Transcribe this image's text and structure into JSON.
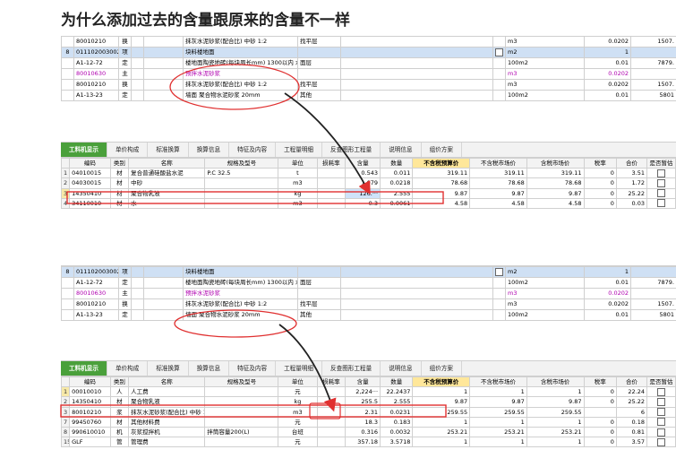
{
  "title": "为什么添加过去的含量跟原来的含量不一样",
  "tabs": [
    "工料机显示",
    "单价构成",
    "标准换算",
    "换算信息",
    "特征及内容",
    "工程量明细",
    "反查图形工程量",
    "说明信息",
    "组价方案"
  ],
  "columns": [
    "编码",
    "类别",
    "名称",
    "规格及型号",
    "单位",
    "损耗率",
    "含量",
    "数量",
    "不含税预算价",
    "不含税市场价",
    "含税市场价",
    "税率",
    "合价",
    "是否暂估"
  ],
  "top_quota": [
    {
      "num": "",
      "code": "80010210",
      "type": "换",
      "name": "抹灰水泥砂浆(配合比) 中砂 1:2",
      "feat": "找平层",
      "unit": "m3",
      "qty": "0.0202",
      "price": "1507."
    },
    {
      "num": "8",
      "code": "011102003002",
      "type": "项",
      "name": "块料楼地面",
      "feat": "",
      "unit": "m2",
      "qty": "1",
      "price": ""
    },
    {
      "num": "",
      "code": "A1-12-72",
      "type": "定",
      "name": "楼地面陶瓷地砖(每块周长mm) 1300以内 水泥砂浆",
      "feat": "面层",
      "unit": "100m2",
      "qty": "0.01",
      "price": "7879."
    },
    {
      "num": "",
      "code": "80010630",
      "type": "主",
      "name": "预拌水泥砂浆",
      "feat": "",
      "unit": "m3",
      "qty": "0.0202",
      "price": ""
    },
    {
      "num": "",
      "code": "80010210",
      "type": "换",
      "name": "抹灰水泥砂浆(配合比) 中砂 1:2",
      "feat": "找平层",
      "unit": "m3",
      "qty": "0.0202",
      "price": "1507."
    },
    {
      "num": "",
      "code": "A1-13-23",
      "type": "定",
      "name": "墙面 聚合物水泥砂浆 20mm",
      "feat": "其他",
      "unit": "100m2",
      "qty": "0.01",
      "price": "5801"
    }
  ],
  "top_resources": [
    {
      "n": "1",
      "code": "04010015",
      "type": "材",
      "name": "复合普通硅酸盐水泥",
      "spec": "P.C 32.5",
      "unit": "t",
      "loss": "",
      "content": "0.543",
      "qty": "0.011",
      "p1": "319.11",
      "p2": "319.11",
      "p3": "319.11",
      "tax": "0",
      "sum": "3.51"
    },
    {
      "n": "2",
      "code": "04030015",
      "type": "材",
      "name": "中砂",
      "spec": "",
      "unit": "m3",
      "loss": "",
      "content": "1.079",
      "qty": "0.0218",
      "p1": "78.68",
      "p2": "78.68",
      "p3": "78.68",
      "tax": "0",
      "sum": "1.72"
    },
    {
      "n": "3",
      "code": "14350410",
      "type": "材",
      "name": "聚合物乳液",
      "spec": "",
      "unit": "kg",
      "loss": "",
      "content": "126.···",
      "qty": "2.555",
      "p1": "9.87",
      "p2": "9.87",
      "p3": "9.87",
      "tax": "0",
      "sum": "25.22"
    },
    {
      "n": "4",
      "code": "34110010",
      "type": "材",
      "name": "水",
      "spec": "",
      "unit": "m3",
      "loss": "",
      "content": "0.3",
      "qty": "0.0061",
      "p1": "4.58",
      "p2": "4.58",
      "p3": "4.58",
      "tax": "0",
      "sum": "0.03"
    }
  ],
  "bottom_quota": [
    {
      "num": "8",
      "code": "011102003002",
      "type": "项",
      "name": "块料楼地面",
      "feat": "",
      "unit": "m2",
      "qty": "1",
      "price": ""
    },
    {
      "num": "",
      "code": "A1-12-72",
      "type": "定",
      "name": "楼地面陶瓷地砖(每块周长mm) 1300以内 水泥砂浆",
      "feat": "面层",
      "unit": "100m2",
      "qty": "0.01",
      "price": "7879."
    },
    {
      "num": "",
      "code": "80010630",
      "type": "主",
      "name": "预拌水泥砂浆",
      "feat": "",
      "unit": "m3",
      "qty": "0.0202",
      "price": ""
    },
    {
      "num": "",
      "code": "80010210",
      "type": "换",
      "name": "抹灰水泥砂浆(配合比) 中砂 1:2",
      "feat": "找平层",
      "unit": "m3",
      "qty": "0.0202",
      "price": "1507."
    },
    {
      "num": "",
      "code": "A1-13-23",
      "type": "定",
      "name": "墙面 聚合物水泥砂浆 20mm",
      "feat": "其他",
      "unit": "100m2",
      "qty": "0.01",
      "price": "5801"
    }
  ],
  "bottom_resources": [
    {
      "n": "1",
      "code": "00010010",
      "type": "人",
      "name": "人工费",
      "spec": "",
      "unit": "元",
      "loss": "",
      "content": "2,224···",
      "qty": "22.2437",
      "p1": "1",
      "p2": "1",
      "p3": "1",
      "tax": "0",
      "sum": "22.24"
    },
    {
      "n": "2",
      "code": "14350410",
      "type": "材",
      "name": "聚合物乳液",
      "spec": "",
      "unit": "kg",
      "loss": "",
      "content": "255.5",
      "qty": "2.555",
      "p1": "9.87",
      "p2": "9.87",
      "p3": "9.87",
      "tax": "0",
      "sum": "25.22"
    },
    {
      "n": "3",
      "code": "80010210",
      "type": "浆",
      "name": "抹灰水泥砂浆(配合比) 中砂 1:2",
      "spec": "",
      "unit": "m3",
      "loss": "",
      "content": "2.31",
      "qty": "0.0231",
      "p1": "259.55",
      "p2": "259.55",
      "p3": "259.55",
      "tax": "",
      "sum": "6"
    },
    {
      "n": "7",
      "code": "99450760",
      "type": "材",
      "name": "其他材料费",
      "spec": "",
      "unit": "元",
      "loss": "",
      "content": "18.3",
      "qty": "0.183",
      "p1": "1",
      "p2": "1",
      "p3": "1",
      "tax": "0",
      "sum": "0.18"
    },
    {
      "n": "8",
      "code": "990610010",
      "type": "机",
      "name": "灰浆搅拌机",
      "spec": "拌筒容量200(L)",
      "unit": "台班",
      "loss": "",
      "content": "0.316",
      "qty": "0.0032",
      "p1": "253.21",
      "p2": "253.21",
      "p3": "253.21",
      "tax": "0",
      "sum": "0.81"
    },
    {
      "n": "15",
      "code": "GLF",
      "type": "管",
      "name": "管理费",
      "spec": "",
      "unit": "元",
      "loss": "",
      "content": "357.18",
      "qty": "3.5718",
      "p1": "1",
      "p2": "1",
      "p3": "1",
      "tax": "0",
      "sum": "3.57"
    }
  ]
}
